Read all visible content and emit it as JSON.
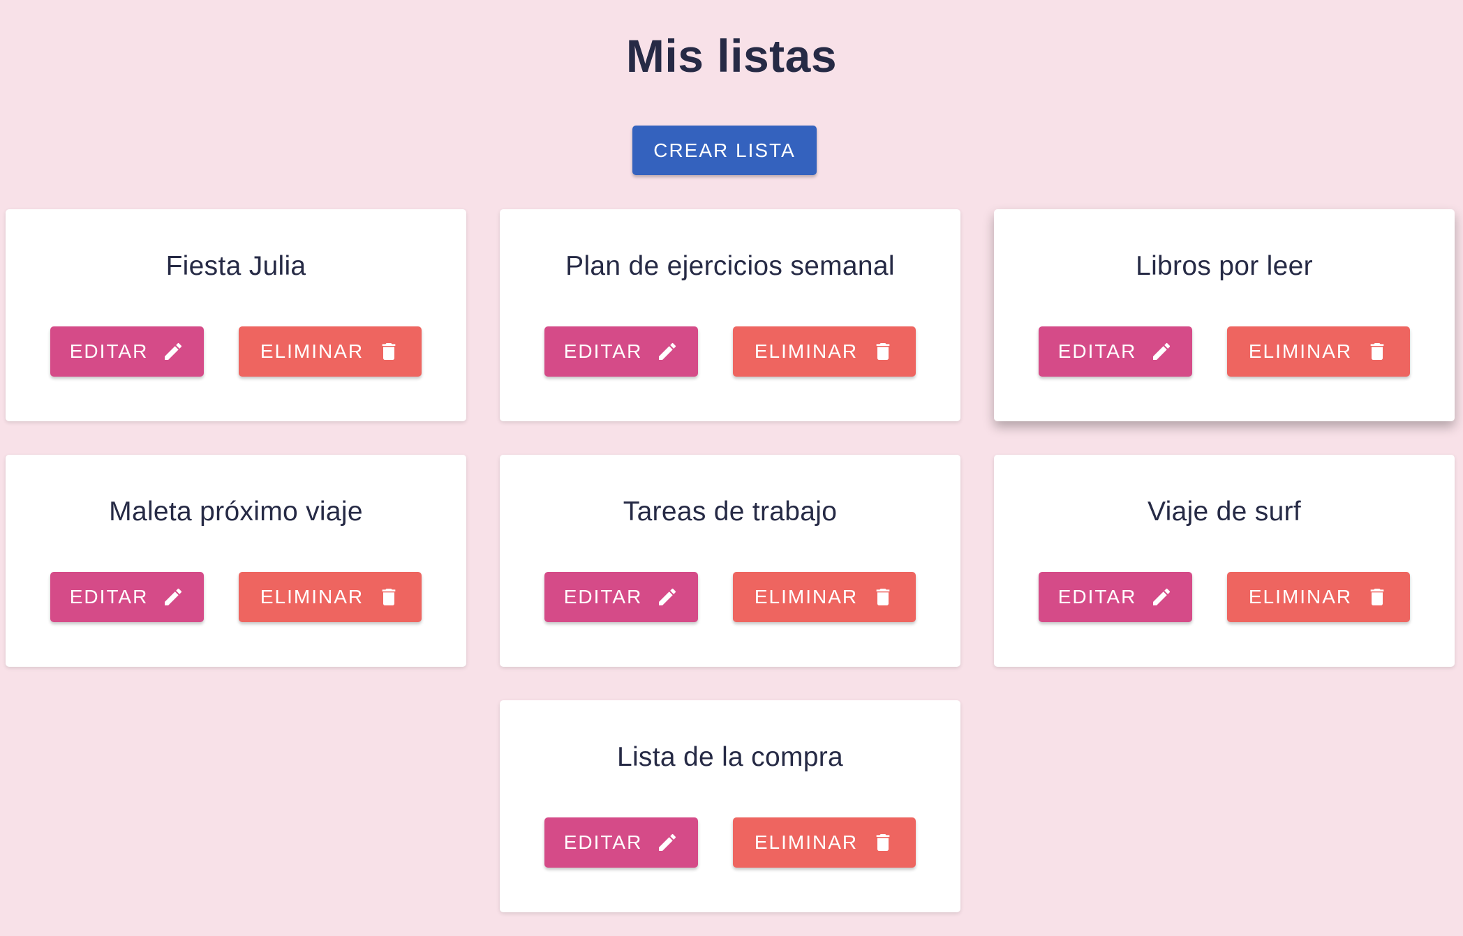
{
  "page": {
    "title": "Mis listas",
    "create_button_label": "CREAR LISTA"
  },
  "lists": [
    {
      "name": "Fiesta Julia",
      "edit_label": "EDITAR",
      "delete_label": "ELIMINAR"
    },
    {
      "name": "Plan de ejercicios semanal",
      "edit_label": "EDITAR",
      "delete_label": "ELIMINAR"
    },
    {
      "name": "Libros por leer",
      "edit_label": "EDITAR",
      "delete_label": "ELIMINAR"
    },
    {
      "name": "Maleta próximo viaje",
      "edit_label": "EDITAR",
      "delete_label": "ELIMINAR"
    },
    {
      "name": "Tareas de trabajo",
      "edit_label": "EDITAR",
      "delete_label": "ELIMINAR"
    },
    {
      "name": "Viaje de surf",
      "edit_label": "EDITAR",
      "delete_label": "ELIMINAR"
    },
    {
      "name": "Lista de la compra",
      "edit_label": "EDITAR",
      "delete_label": "ELIMINAR"
    }
  ],
  "icons": {
    "edit": "pencil-icon",
    "delete": "trash-icon"
  },
  "colors": {
    "background": "#f8e1e8",
    "primary": "#3462be",
    "edit": "#d54b88",
    "delete": "#ee6560",
    "text": "#262a45"
  }
}
